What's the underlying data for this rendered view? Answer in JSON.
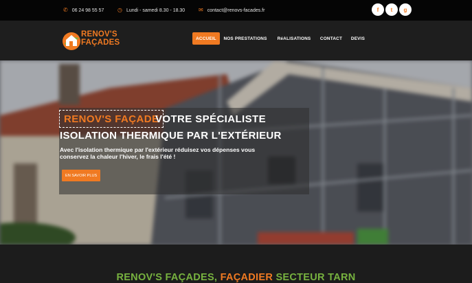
{
  "topbar": {
    "phone": "06 24 98 55 57",
    "hours": "Lundi - samedi 8.30 - 18.30",
    "email": "contact@renovs-facades.fr",
    "phone_icon": "phone-icon",
    "clock_icon": "clock-icon",
    "mail_icon": "mail-icon",
    "socials": [
      {
        "name": "facebook-icon",
        "glyph": "f"
      },
      {
        "name": "twitter-icon",
        "glyph": "t"
      },
      {
        "name": "google-plus-icon",
        "glyph": "g"
      }
    ]
  },
  "header": {
    "logo_line1": "RENOV'S",
    "logo_line2": "FAÇADES",
    "nav": [
      "ACCUEIL",
      "NOS PRESTATIONS",
      "RéALISATIONS",
      "CONTACT",
      "DEVIS"
    ],
    "active_nav": "ACCUEIL"
  },
  "hero": {
    "brand": "RENOV'S FAÇADE",
    "title_line1": "VOTRE SPÉCIALISTE",
    "title_line2": "ISOLATION THERMIQUE PAR L'EXTÉRIEUR",
    "text": "Avec l'isolation thermique par l'extérieur réduisez vos dépenses vous conservez la chaleur l'hiver, le frais l'été !",
    "button": "EN SAVOIR PLUS"
  },
  "section": {
    "title_part1": "RENOV'S FAÇADES, ",
    "title_part2": "FAÇADIER",
    "title_part3": " SECTEUR TARN"
  },
  "colors": {
    "accent": "#f07a22",
    "green": "#77b23f",
    "topbar": "#050505",
    "header": "#1e1e1e"
  }
}
